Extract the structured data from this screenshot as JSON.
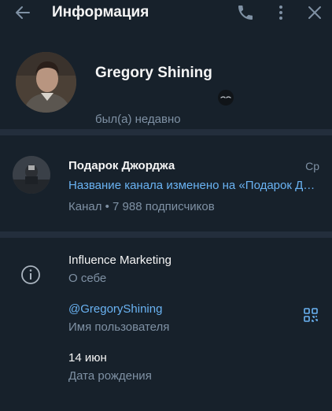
{
  "header": {
    "title": "Информация"
  },
  "profile": {
    "name": "Gregory Shining",
    "status": "был(а) недавно"
  },
  "channel": {
    "name": "Подарок Джорджа",
    "time": "Ср",
    "last_message": "Название канала изменено на «Подарок Джорджа»",
    "meta": "Канал • 7 988 подписчиков"
  },
  "info": {
    "bio_value": "Influence Marketing",
    "bio_label": "О себе",
    "username_value": "@GregoryShining",
    "username_label": "Имя пользователя",
    "birthday_value": "14 июн",
    "birthday_label": "Дата рождения"
  },
  "colors": {
    "background": "#17212b",
    "divider": "#232e3c",
    "accent": "#6ab3f3",
    "secondary_text": "#7f91a4"
  },
  "icons": [
    "back-arrow-icon",
    "phone-icon",
    "more-vertical-icon",
    "close-icon",
    "info-icon",
    "qr-code-icon",
    "emoji-status-icon"
  ]
}
